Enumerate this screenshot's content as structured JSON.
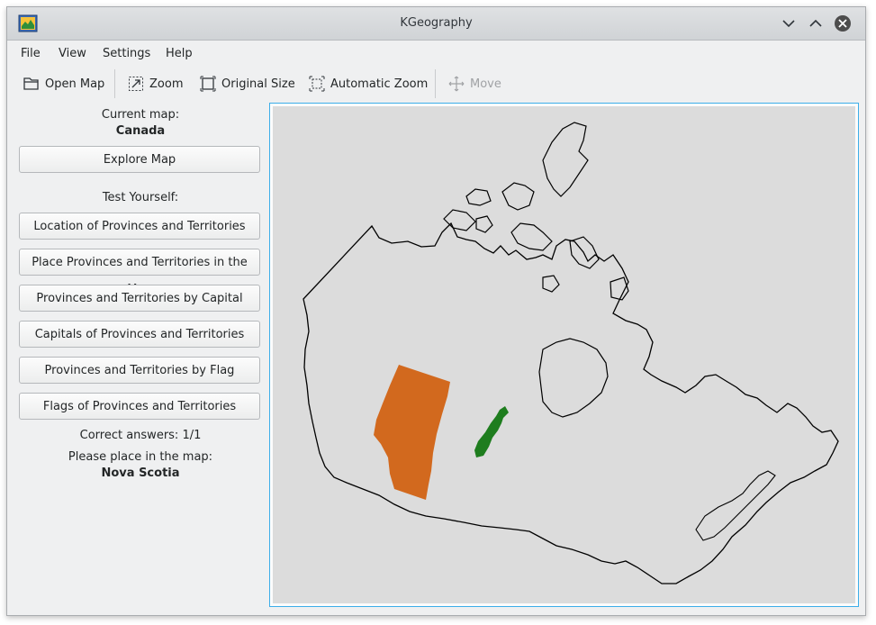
{
  "window": {
    "title": "KGeography"
  },
  "menu": {
    "file": "File",
    "view": "View",
    "settings": "Settings",
    "help": "Help"
  },
  "toolbar": {
    "open_map": "Open Map",
    "zoom": "Zoom",
    "original_size": "Original Size",
    "automatic_zoom": "Automatic Zoom",
    "move": "Move"
  },
  "panel": {
    "current_map_label": "Current map:",
    "current_map": "Canada",
    "explore_map": "Explore Map",
    "test_yourself": "Test Yourself:",
    "buttons": [
      "Location of Provinces and Territories",
      "Place Provinces and Territories in the Map",
      "Provinces and Territories by Capital",
      "Capitals of Provinces and Territories",
      "Provinces and Territories by Flag",
      "Flags of Provinces and Territories"
    ],
    "correct_answers": "Correct answers: 1/1",
    "place_prompt": "Please place in the map:",
    "target": "Nova Scotia"
  },
  "colors": {
    "accent": "#3daee9",
    "map_background": "#dcdcdc",
    "placed_province": "#d2691e",
    "target_province": "#1e7d1e"
  }
}
